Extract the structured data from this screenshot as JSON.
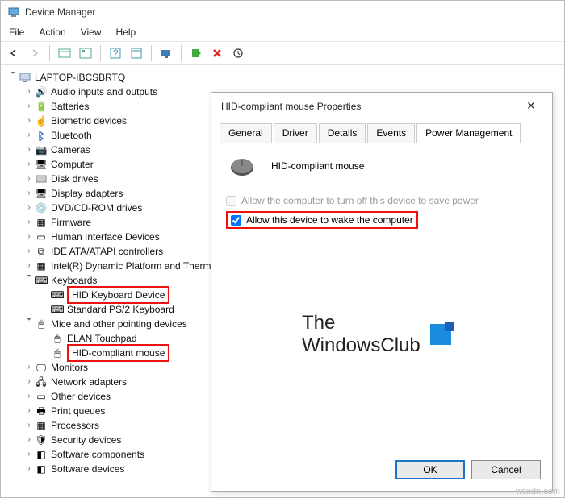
{
  "window": {
    "title": "Device Manager"
  },
  "menu": {
    "file": "File",
    "action": "Action",
    "view": "View",
    "help": "Help"
  },
  "root": {
    "name": "LAPTOP-IBCSBRTQ"
  },
  "cats": {
    "audio": "Audio inputs and outputs",
    "batt": "Batteries",
    "biom": "Biometric devices",
    "bt": "Bluetooth",
    "cam": "Cameras",
    "comp": "Computer",
    "disk": "Disk drives",
    "disp": "Display adapters",
    "dvd": "DVD/CD-ROM drives",
    "fw": "Firmware",
    "hid": "Human Interface Devices",
    "ide": "IDE ATA/ATAPI controllers",
    "intel": "Intel(R) Dynamic Platform and Thermal Framework",
    "kb": "Keyboards",
    "kb_hid": "HID Keyboard Device",
    "kb_ps2": "Standard PS/2 Keyboard",
    "mice": "Mice and other pointing devices",
    "mice_elan": "ELAN Touchpad",
    "mice_hid": "HID-compliant mouse",
    "mon": "Monitors",
    "net": "Network adapters",
    "other": "Other devices",
    "printq": "Print queues",
    "proc": "Processors",
    "sec": "Security devices",
    "swc": "Software components",
    "swd": "Software devices"
  },
  "dlg": {
    "title": "HID-compliant mouse Properties",
    "tabs": {
      "general": "General",
      "driver": "Driver",
      "details": "Details",
      "events": "Events",
      "power": "Power Management"
    },
    "device_name": "HID-compliant mouse",
    "opt_turnoff": "Allow the computer to turn off this device to save power",
    "opt_wake": "Allow this device to wake the computer",
    "ok": "OK",
    "cancel": "Cancel"
  },
  "brand": {
    "line1": "The",
    "line2": "WindowsClub"
  },
  "watermark": "wsxdn.com"
}
